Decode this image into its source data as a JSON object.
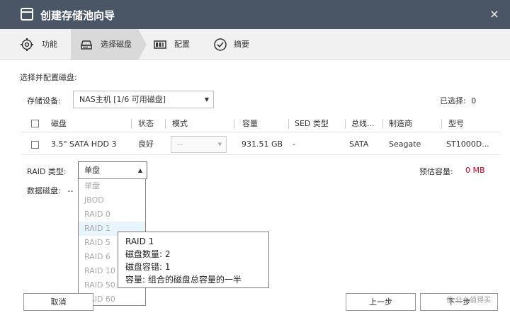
{
  "window": {
    "title": "创建存储池向导",
    "close": "×"
  },
  "steps": [
    {
      "label": "功能",
      "icon": "gear-icon"
    },
    {
      "label": "选择磁盘",
      "icon": "disk-icon"
    },
    {
      "label": "配置",
      "icon": "raid-config-icon"
    },
    {
      "label": "摘要",
      "icon": "check-circle-icon"
    }
  ],
  "active_step": 1,
  "section_title": "选择并配置磁盘:",
  "device": {
    "label": "存储设备:",
    "value": "NAS主机 [1/6 可用磁盘]"
  },
  "selected": {
    "label": "已选择:",
    "count": "0"
  },
  "table": {
    "headers": [
      "磁盘",
      "状态",
      "模式",
      "容量",
      "SED 类型",
      "总线...",
      "制造商",
      "型号"
    ],
    "rows": [
      {
        "disk": "3.5\" SATA HDD 3",
        "status": "良好",
        "mode": "--",
        "capacity": "931.51 GB",
        "sed": "-",
        "bus": "SATA",
        "vendor": "Seagate",
        "model": "ST1000D..."
      }
    ]
  },
  "raid": {
    "label": "RAID 类型:",
    "value": "单盘",
    "options": [
      "单盘",
      "JBOD",
      "RAID 0",
      "RAID 1",
      "RAID 5",
      "RAID 6",
      "RAID 10",
      "RAID 50",
      "RAID 60"
    ],
    "highlighted": 3
  },
  "capacity": {
    "label": "预估容量:",
    "value": "0 MB",
    "color": "#d0021b"
  },
  "data_disk": {
    "label": "数据磁盘:",
    "value": "--"
  },
  "tooltip": {
    "title": "RAID 1",
    "lines": [
      "磁盘数量:  2",
      "磁盘容错:  1",
      "容量:  组合的磁盘总容量的一半"
    ]
  },
  "buttons": {
    "cancel": "取消",
    "prev": "上一步",
    "next": "下一步"
  },
  "watermark": "值 什么值得买",
  "colors": {
    "titlebar": "#4a5566",
    "accent_red": "#d0021b",
    "highlight": "#e8f4fb"
  }
}
